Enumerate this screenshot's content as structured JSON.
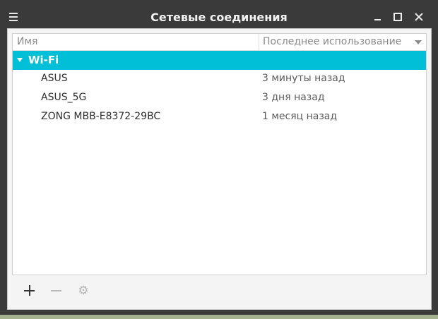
{
  "window": {
    "title": "Сетевые соединения"
  },
  "list": {
    "columns": {
      "name": "Имя",
      "last_used": "Последнее использование"
    },
    "group": {
      "label": "Wi-Fi"
    },
    "connections": [
      {
        "name": "ASUS",
        "last_used": "3 минуты назад"
      },
      {
        "name": "ASUS_5G",
        "last_used": "3 дня назад"
      },
      {
        "name": "ZONG MBB-E8372-29BC",
        "last_used": "1 месяц назад"
      }
    ]
  },
  "icons": {
    "menu": "menu-icon",
    "minimize": "minimize-icon",
    "maximize": "maximize-icon",
    "close": "close-icon",
    "sort": "sort-descending-icon",
    "expander": "expander-down-icon",
    "add": "plus-icon",
    "remove": "minus-icon",
    "settings": "gear-icon"
  },
  "colors": {
    "titlebar": "#3a3a3a",
    "selection": "#00bfd6",
    "background": "#f4f4f4"
  }
}
